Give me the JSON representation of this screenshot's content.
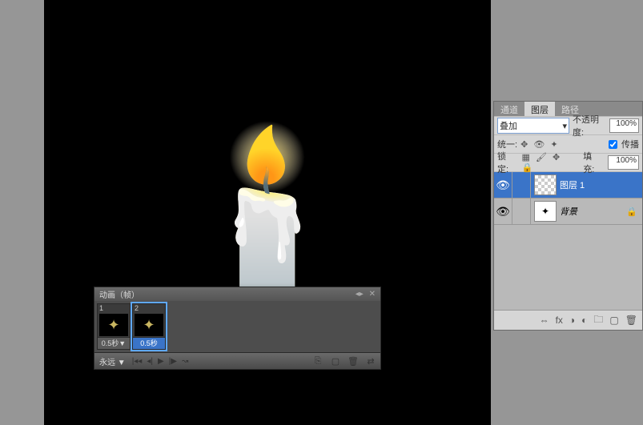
{
  "animation": {
    "title": "动画（帧）",
    "frames": [
      {
        "num": "1",
        "duration": "0.5秒▼",
        "selected": false
      },
      {
        "num": "2",
        "duration": "0.5秒",
        "selected": true
      }
    ],
    "loop": "永远 ▼"
  },
  "layers": {
    "tabs": {
      "channels": "通道",
      "layers": "图层",
      "paths": "路径"
    },
    "blend_mode": "叠加",
    "opacity_label": "不透明度:",
    "opacity_value": "100%",
    "unify_label": "统一:",
    "propagate_label": "传播",
    "lock_label": "锁定:",
    "fill_label": "填充:",
    "fill_value": "100%",
    "items": [
      {
        "name": "图层 1",
        "selected": true,
        "checker": true,
        "locked": false
      },
      {
        "name": "背景",
        "selected": false,
        "checker": false,
        "locked": true
      }
    ]
  }
}
